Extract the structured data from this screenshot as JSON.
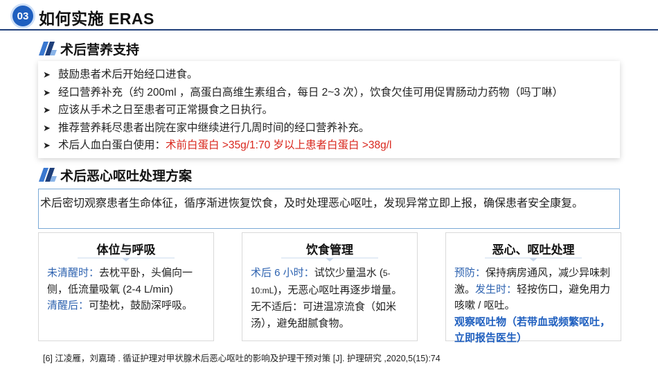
{
  "header": {
    "number": "03",
    "title": "如何实施 ERAS"
  },
  "nutrition": {
    "title": "术后营养支持",
    "bullets": [
      {
        "text": "鼓励患者术后开始经口进食。"
      },
      {
        "text": "经口营养补充（约 200ml ，高蛋白高维生素组合，每日 2~3 次），饮食欠佳可用促胃肠动力药物（吗丁啉）"
      },
      {
        "text": "应该从手术之日至患者可正常摄食之日执行。"
      },
      {
        "text": "推荐营养耗尽患者出院在家中继续进行几周时间的经口营养补充。"
      },
      {
        "text": "术后人血白蛋白使用：",
        "highlight": "术前白蛋白 >35g/1:70 岁以上患者白蛋白 >38g/l"
      }
    ]
  },
  "nausea": {
    "title": "术后恶心呕吐处理方案",
    "intro": "术后密切观察患者生命体征，循序渐进恢复饮食，及时处理恶心呕吐，发现异常立即上报，确保患者安全康复。",
    "cards": [
      {
        "title": "体位与呼吸",
        "p1_label": "未清醒时：",
        "p1_text": "去枕平卧，头偏向一侧，低流量吸氧 (2-4 L/min)",
        "p2_label": "清醒后：",
        "p2_text": "可垫枕，鼓励深呼吸。"
      },
      {
        "title": "饮食管理",
        "p1_label": "术后 6 小时：",
        "p1_text": "试饮少量温水 (",
        "p1_small": "5-10:mL",
        "p1_text2": ")，无恶心呕吐再逐步增量。无不适后：可进温凉流食（如米汤），避免甜腻食物。"
      },
      {
        "title": "恶心、呕吐处理",
        "p1_label": "预防：",
        "p1_text": "保持病房通风，减少异味刺激。",
        "p2_label": "发生时：",
        "p2_text": "轻按伤口，避免用力咳嗽 / 呕吐。",
        "p3_bold": "观察呕吐物（若带血或频繁呕吐，立即报告医生）"
      }
    ]
  },
  "reference": "[6] 江凌雁，刘嘉琦 . 循证护理对甲状腺术后恶心呕吐的影响及护理干预对策  [J]. 护理研究  ,2020,5(15):74",
  "colors": {
    "accent_blue": "#1f5fbf",
    "highlight_red": "#d9261c",
    "dark_navy": "#1f3f7a"
  }
}
